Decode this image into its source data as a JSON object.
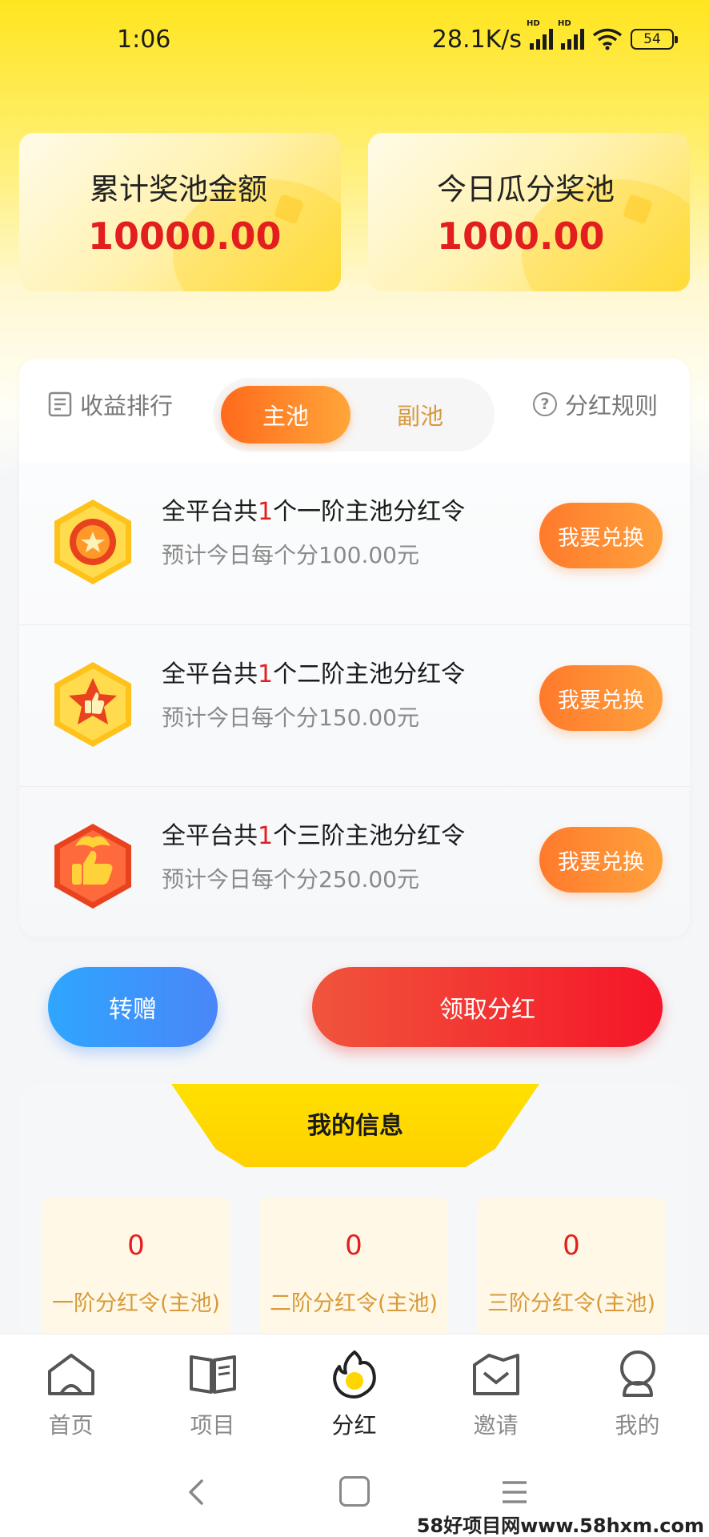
{
  "status_bar": {
    "time": "1:06",
    "speed": "28.1K/s",
    "signal_label": "HD",
    "battery": "54"
  },
  "pools": {
    "total": {
      "title": "累计奖池金额",
      "amount": "10000.00"
    },
    "today": {
      "title": "今日瓜分奖池",
      "amount": "1000.00"
    }
  },
  "card_header": {
    "rank_label": "收益排行",
    "rules_label": "分红规则",
    "rules_icon": "?",
    "seg_main": "主池",
    "seg_sub": "副池"
  },
  "dividend_rows": [
    {
      "title_pre": "全平台共",
      "count": "1",
      "title_post": "个一阶主池分红令",
      "subtitle": "预计今日每个分100.00元",
      "button": "我要兑换"
    },
    {
      "title_pre": "全平台共",
      "count": "1",
      "title_post": "个二阶主池分红令",
      "subtitle": "预计今日每个分150.00元",
      "button": "我要兑换"
    },
    {
      "title_pre": "全平台共",
      "count": "1",
      "title_post": "个三阶主池分红令",
      "subtitle": "预计今日每个分250.00元",
      "button": "我要兑换"
    }
  ],
  "actions": {
    "gift": "转赠",
    "claim": "领取分红"
  },
  "my_info": {
    "title": "我的信息",
    "stats": [
      {
        "value": "0",
        "label": "一阶分红令(主池)"
      },
      {
        "value": "0",
        "label": "二阶分红令(主池)"
      },
      {
        "value": "0",
        "label": "三阶分红令(主池)"
      }
    ]
  },
  "tabbar": [
    {
      "label": "首页",
      "icon": "home-icon"
    },
    {
      "label": "项目",
      "icon": "book-icon"
    },
    {
      "label": "分红",
      "icon": "flame-icon",
      "active": true
    },
    {
      "label": "邀请",
      "icon": "envelope-icon"
    },
    {
      "label": "我的",
      "icon": "user-icon"
    }
  ],
  "watermark": "58好项目网www.58hxm.com",
  "colors": {
    "accent_orange": "#ff7a2c",
    "amount_red": "#e21e1e",
    "brand_yellow": "#ffe100",
    "gift_blue": "#2ea6ff",
    "claim_red": "#f51528"
  }
}
